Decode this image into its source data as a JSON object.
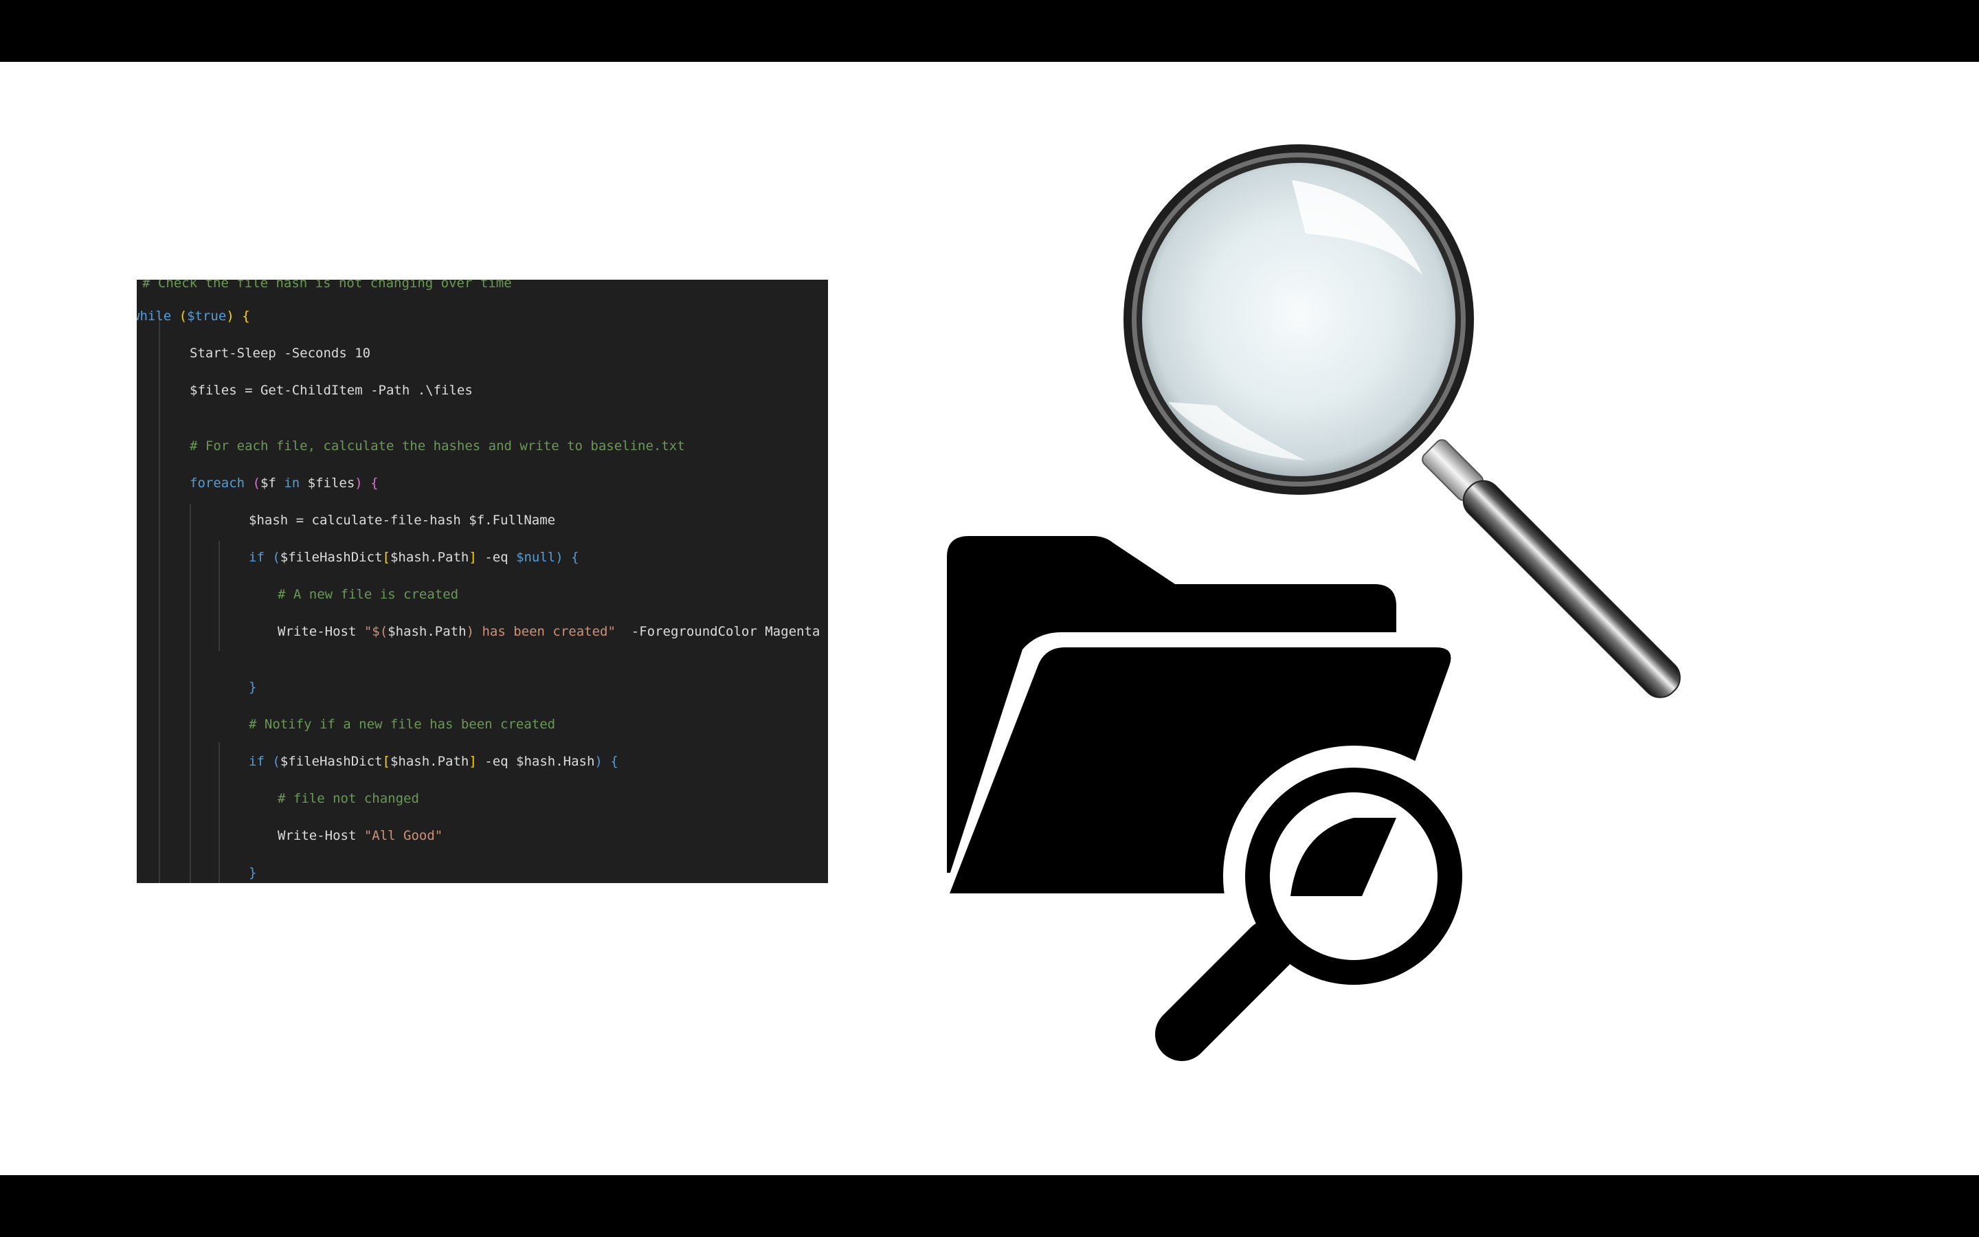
{
  "colors": {
    "editor_background": "#1f1f1f",
    "keyword": "#569cd6",
    "comment": "#6a9955",
    "string": "#ce9178",
    "text": "#dcdcdc",
    "bracket_gold": "#ffd700",
    "bracket_purple": "#da70d6",
    "letterbox": "#000000"
  },
  "code": {
    "lines": [
      [
        {
          "t": "comment",
          "v": "# Check the file hash is not changing over time"
        }
      ],
      [
        {
          "t": "keyword",
          "v": "while"
        },
        {
          "t": "text",
          "v": " "
        },
        {
          "t": "bracket_gold",
          "v": "("
        },
        {
          "t": "keyword",
          "v": "$true"
        },
        {
          "t": "bracket_gold",
          "v": ")"
        },
        {
          "t": "text",
          "v": " "
        },
        {
          "t": "bracket_gold",
          "v": "{"
        }
      ],
      [
        {
          "t": "text",
          "v": "Start-Sleep -Seconds 10"
        }
      ],
      [
        {
          "t": "text",
          "v": "$files = Get-ChildItem -Path .\\files"
        }
      ],
      [
        {
          "t": "comment",
          "v": "# For each file, calculate the hashes and write to baseline.txt"
        }
      ],
      [
        {
          "t": "keyword",
          "v": "foreach"
        },
        {
          "t": "text",
          "v": " "
        },
        {
          "t": "bracket_purple",
          "v": "("
        },
        {
          "t": "text",
          "v": "$f "
        },
        {
          "t": "keyword",
          "v": "in"
        },
        {
          "t": "text",
          "v": " $files"
        },
        {
          "t": "bracket_purple",
          "v": ")"
        },
        {
          "t": "text",
          "v": " "
        },
        {
          "t": "bracket_purple",
          "v": "{"
        }
      ],
      [
        {
          "t": "text",
          "v": "$hash = calculate-file-hash $f.FullName"
        }
      ],
      [
        {
          "t": "keyword",
          "v": "if"
        },
        {
          "t": "text",
          "v": " "
        },
        {
          "t": "keyword",
          "v": "("
        },
        {
          "t": "text",
          "v": "$fileHashDict"
        },
        {
          "t": "bracket_gold",
          "v": "["
        },
        {
          "t": "text",
          "v": "$hash.Path"
        },
        {
          "t": "bracket_gold",
          "v": "]"
        },
        {
          "t": "text",
          "v": " -eq "
        },
        {
          "t": "keyword",
          "v": "$null"
        },
        {
          "t": "keyword",
          "v": ")"
        },
        {
          "t": "text",
          "v": " "
        },
        {
          "t": "keyword",
          "v": "{"
        }
      ],
      [
        {
          "t": "comment",
          "v": "# A new file is created"
        }
      ],
      [
        {
          "t": "text",
          "v": "Write-Host "
        },
        {
          "t": "string",
          "v": "\"$("
        },
        {
          "t": "text",
          "v": "$hash.Path"
        },
        {
          "t": "string",
          "v": ") has been created\""
        },
        {
          "t": "text",
          "v": "  -ForegroundColor Magenta"
        }
      ],
      [
        {
          "t": "keyword",
          "v": "}"
        }
      ],
      [
        {
          "t": "comment",
          "v": "# Notify if a new file has been created"
        }
      ],
      [
        {
          "t": "keyword",
          "v": "if"
        },
        {
          "t": "text",
          "v": " "
        },
        {
          "t": "keyword",
          "v": "("
        },
        {
          "t": "text",
          "v": "$fileHashDict"
        },
        {
          "t": "bracket_gold",
          "v": "["
        },
        {
          "t": "text",
          "v": "$hash.Path"
        },
        {
          "t": "bracket_gold",
          "v": "]"
        },
        {
          "t": "text",
          "v": " -eq $hash.Hash"
        },
        {
          "t": "keyword",
          "v": ")"
        },
        {
          "t": "text",
          "v": " "
        },
        {
          "t": "keyword",
          "v": "{"
        }
      ],
      [
        {
          "t": "comment",
          "v": "# file not changed"
        }
      ],
      [
        {
          "t": "text",
          "v": "Write-Host "
        },
        {
          "t": "string",
          "v": "\"All Good\""
        }
      ],
      [
        {
          "t": "keyword",
          "v": "}"
        }
      ]
    ]
  },
  "icons": {
    "magnifier": "magnifying-glass-icon",
    "folder_search": "folder-search-icon"
  }
}
